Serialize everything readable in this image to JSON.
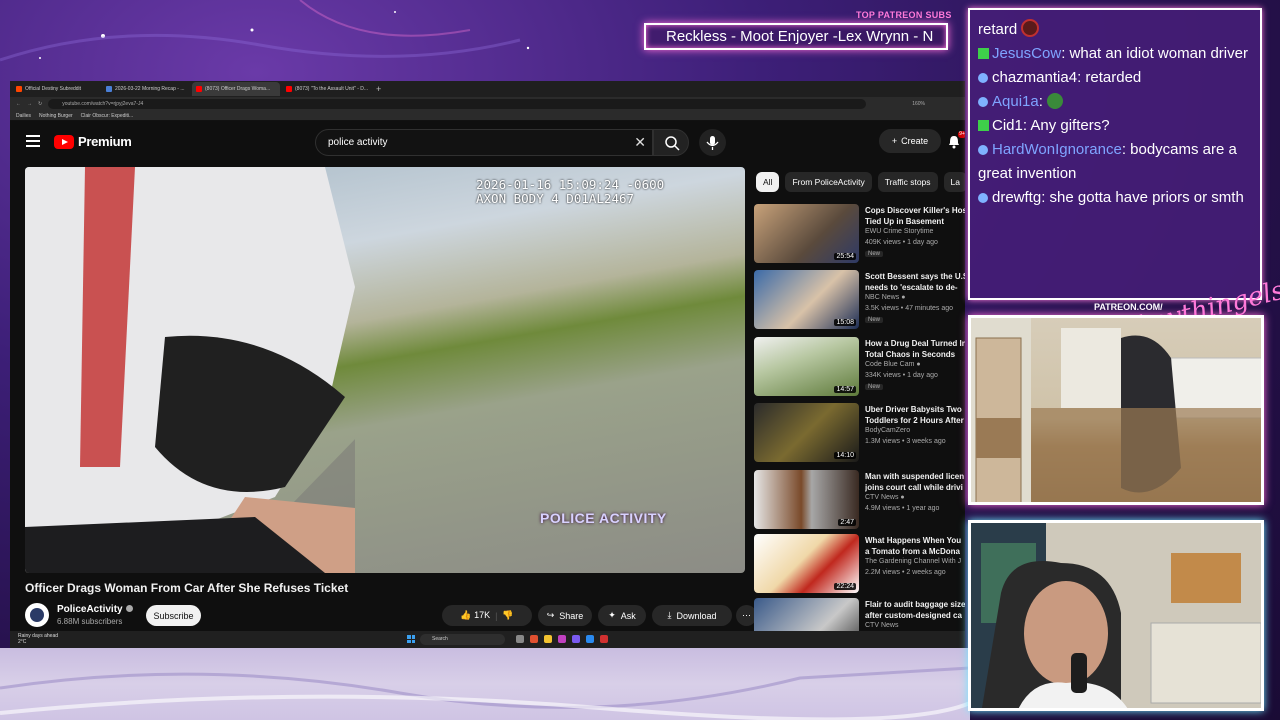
{
  "overlay": {
    "patreon_label": "TOP PATREON SUBS",
    "patreon_scroll": "Reckless - Moot Enjoyer -Lex Wrynn - N",
    "patreon_url": "PATREON.COM/",
    "signature": "Anythingelse"
  },
  "browser": {
    "tabs": [
      {
        "label": "Official Destiny Subreddit",
        "color": "#ff4500"
      },
      {
        "label": "2026-03-22 Morning Recap - ...",
        "color": "#4a7fd6"
      },
      {
        "label": "(8073) Officer Drags Woma...",
        "color": "#ff0000"
      },
      {
        "label": "(8073) \"To the Assault Unit\" - D...",
        "color": "#ff0000"
      }
    ],
    "url": "youtube.com/watch?v=rjpyj2eva7-J4",
    "zoom": "160%",
    "bookmarks": [
      "Dailies",
      "Nothing Burger",
      "Clair Obscur: Expediti..."
    ]
  },
  "youtube": {
    "logo_text": "Premium",
    "search_value": "police activity",
    "create_label": "Create",
    "notification_count": "9+",
    "video": {
      "timestamp_line1": "2026-01-16 15:09:24 -0600",
      "timestamp_line2": "AXON BODY 4 D01AL2467",
      "watermark": "POLICE ACTIVITY",
      "title": "Officer Drags Woman From Car After She Refuses Ticket",
      "channel": "PoliceActivity",
      "subscribers": "6.88M subscribers",
      "subscribe_label": "Subscribe",
      "likes": "17K",
      "share_label": "Share",
      "ask_label": "Ask",
      "download_label": "Download"
    },
    "chips": [
      "All",
      "From PoliceActivity",
      "Traffic stops",
      "La"
    ],
    "recommendations": [
      {
        "title1": "Cops Discover Killer's Hos",
        "title2": "Tied Up in Basement",
        "channel": "EWU Crime Storytime",
        "meta": "409K views • 1 day ago",
        "new": "New",
        "duration": "25:54"
      },
      {
        "title1": "Scott Bessent says the U.S",
        "title2": "needs to 'escalate to de-",
        "channel": "NBC News",
        "meta": "3.5K views • 47 minutes ago",
        "new": "New",
        "duration": "15:08"
      },
      {
        "title1": "How a Drug Deal Turned In",
        "title2": "Total Chaos in Seconds",
        "channel": "Code Blue Cam",
        "meta": "334K views • 1 day ago",
        "new": "New",
        "duration": "14:57"
      },
      {
        "title1": "Uber Driver Babysits Two",
        "title2": "Toddlers for 2 Hours After",
        "channel": "BodyCamZero",
        "meta": "1.3M views • 3 weeks ago",
        "new": "",
        "duration": "14:10"
      },
      {
        "title1": "Man with suspended licen",
        "title2": "joins court call while drivi",
        "channel": "CTV News",
        "meta": "4.9M views • 1 year ago",
        "new": "",
        "duration": "2:47"
      },
      {
        "title1": "What Happens When You",
        "title2": "a Tomato from a McDona",
        "channel": "The Gardening Channel With J",
        "meta": "2.2M views • 2 weeks ago",
        "new": "",
        "duration": "22:24"
      },
      {
        "title1": "Flair to audit baggage size",
        "title2": "after custom-designed ca",
        "channel": "CTV News",
        "meta": "",
        "new": "",
        "duration": ""
      }
    ]
  },
  "taskbar": {
    "weather": "Rainy days ahead",
    "temp": "2°C",
    "search": "Search"
  },
  "chat": [
    {
      "user": "",
      "text": "retard",
      "badge": "none",
      "blue": false
    },
    {
      "user": "JesusCow",
      "text": ": what an idiot woman driver",
      "badge": "k",
      "blue": true
    },
    {
      "user": "chazmantia4",
      "text": ": retarded",
      "badge": "dot",
      "blue": false
    },
    {
      "user": "Aqui1a",
      "text": ":",
      "badge": "dot",
      "blue": true
    },
    {
      "user": "Cid1",
      "text": ":  Any gifters?",
      "badge": "k",
      "blue": false
    },
    {
      "user": "HardWonIgnorance",
      "text": ": bodycams are a great invention",
      "badge": "dot",
      "blue": true
    },
    {
      "user": "drewftg",
      "text": ": she gotta have priors or smth",
      "badge": "dot",
      "blue": false
    }
  ]
}
